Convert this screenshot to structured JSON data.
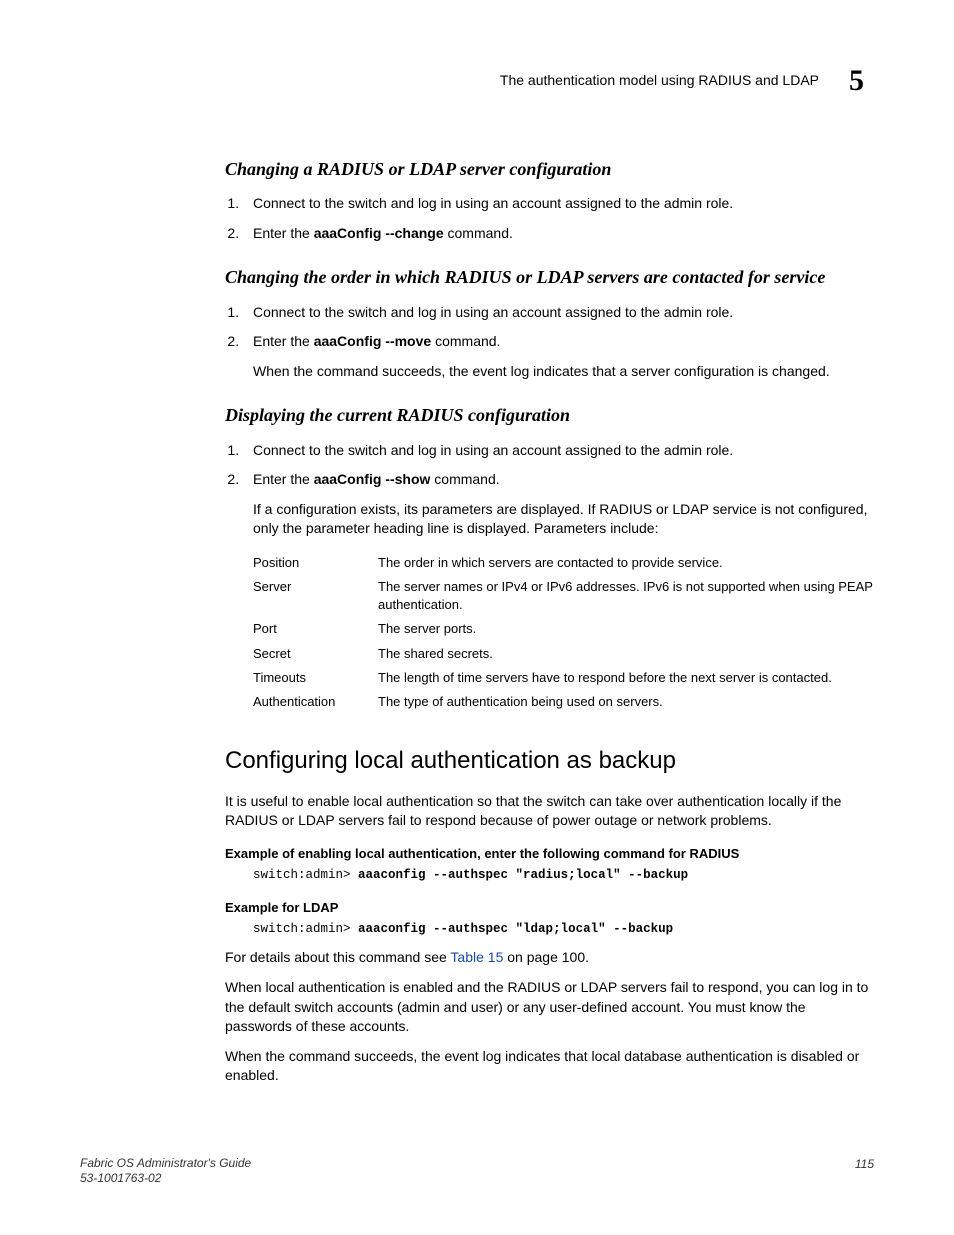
{
  "header": {
    "running_title": "The authentication model using RADIUS and LDAP",
    "chapter_number": "5"
  },
  "sec1": {
    "heading": "Changing a RADIUS or LDAP server configuration",
    "step1": "Connect to the switch and log in using an account assigned to the admin role.",
    "step2_pre": "Enter the ",
    "step2_cmd1": "aaaConfig",
    "step2_sep": " ",
    "step2_opt": "--change",
    "step2_post": "  command."
  },
  "sec2": {
    "heading": "Changing the order in which RADIUS or LDAP servers are contacted for service",
    "step1": "Connect to the switch and log in using an account assigned to the admin role.",
    "step2_pre": "Enter the ",
    "step2_cmd1": "aaaConfig",
    "step2_opt": "--move",
    "step2_post": "  command.",
    "note": "When the command succeeds, the event log indicates that a server configuration is changed."
  },
  "sec3": {
    "heading": "Displaying the current RADIUS configuration",
    "step1": "Connect to the switch and log in using an account assigned to the admin role.",
    "step2_pre": "Enter the ",
    "step2_cmd1": "aaaConfig",
    "step2_opt": "--show",
    "step2_post": "  command.",
    "note": "If a configuration exists, its parameters are displayed. If RADIUS or LDAP service is not configured, only the parameter heading line is displayed. Parameters include:",
    "params": [
      {
        "k": "Position",
        "v": "The order in which servers are contacted to provide service."
      },
      {
        "k": "Server",
        "v": "The server names or IPv4 or IPv6 addresses. IPv6 is not supported when using PEAP authentication."
      },
      {
        "k": "Port",
        "v": "The server ports."
      },
      {
        "k": "Secret",
        "v": "The shared secrets."
      },
      {
        "k": "Timeouts",
        "v": "The length of time servers have to respond before the next server is contacted."
      },
      {
        "k": "Authentication",
        "v": "The type of authentication being used on servers."
      }
    ]
  },
  "sec4": {
    "heading": "Configuring local authentication as backup",
    "intro": "It is useful to enable local authentication so that the switch can take over authentication locally if the RADIUS or LDAP servers fail to respond because of power outage or network problems.",
    "ex1_title": "Example  of enabling local authentication, enter the following command for RADIUS",
    "ex1_prompt": "switch:admin> ",
    "ex1_cmd": "aaaconfig --authspec \"radius;local\" --backup",
    "ex2_title": "Example  for LDAP",
    "ex2_prompt": "switch:admin> ",
    "ex2_cmd": "aaaconfig --authspec \"ldap;local\" --backup",
    "details_pre": "For details about this command see ",
    "details_link": "Table 15",
    "details_post": " on page 100.",
    "para2": "When local authentication is enabled and the RADIUS or LDAP servers fail to respond, you can log in to the default switch accounts (admin and user) or any user-defined account. You must know the passwords of these accounts.",
    "para3": "When the command succeeds, the event log indicates that local database authentication is disabled or enabled."
  },
  "footer": {
    "title": "Fabric OS Administrator's Guide",
    "doc_id": "53-1001763-02",
    "page": "115"
  }
}
